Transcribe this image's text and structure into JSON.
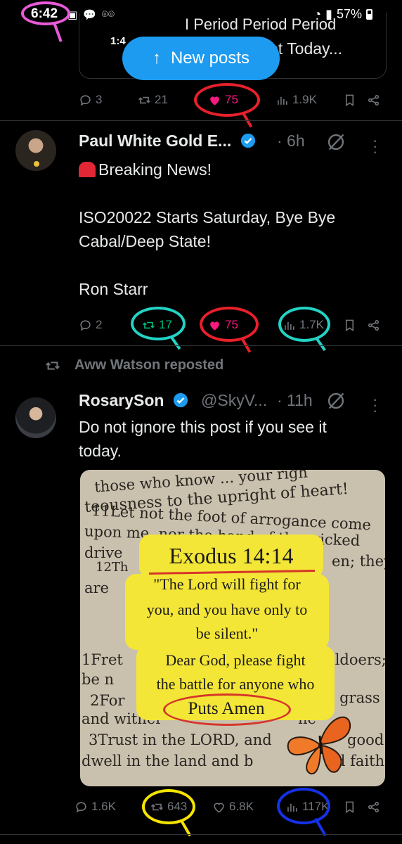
{
  "status_bar": {
    "time": "6:42",
    "battery": "57%"
  },
  "quoted_card": {
    "top_text": "I Period Period Period",
    "time": "1:4",
    "text": "et Today..."
  },
  "new_posts_button": {
    "label": "New posts"
  },
  "tweet0_actions": {
    "replies": "3",
    "reposts": "21",
    "likes": "75",
    "views": "1.9K"
  },
  "tweet1": {
    "name": "Paul White Gold E...",
    "time": "· 6h",
    "lines": [
      "Breaking News!",
      "",
      "ISO20022 Starts Saturday, Bye Bye",
      "Cabal/Deep State!",
      "",
      "Ron Starr"
    ],
    "actions": {
      "replies": "2",
      "reposts": "17",
      "likes": "75",
      "views": "1.7K"
    }
  },
  "repost_label": "Aww Watson reposted",
  "tweet2": {
    "name": "RosarySon",
    "handle": "@SkyV...",
    "time": "· 11h",
    "lines": [
      "Do not ignore this post if you see it",
      "today."
    ],
    "image": {
      "page_lines": [
        "those who know ... your righ",
        "teousness to the upright of heart!",
        "11Let not the foot of arrogance come",
        "upon me, nor the hand of the wicked",
        "drive",
        "12Th",
        "are",
        "1Fret",
        "be n",
        "2For",
        "and wither",
        "3Trust in the LORD, and",
        "dwell in the land and b"
      ],
      "page_right": [
        "en; they",
        "ildoers;",
        "e grass",
        "he",
        "good",
        "d faith"
      ],
      "title": "Exodus 14:14",
      "quote": [
        "\"The Lord will fight for",
        "you, and you have only to",
        "be silent.\""
      ],
      "prayer": [
        "Dear God, please fight",
        "the battle for anyone who"
      ],
      "amen": "Puts Amen"
    },
    "actions": {
      "replies": "1.6K",
      "reposts": "643",
      "likes": "6.8K",
      "views": "117K"
    }
  },
  "colors": {
    "accent": "#1d9bf0",
    "like_pink": "#f91880",
    "repost_green": "#00ba7c",
    "muted": "#71767b",
    "annot_magenta": "#e85ad8",
    "annot_red": "#e8202a",
    "annot_cyan": "#22d3c5",
    "annot_yellow": "#f5e400",
    "annot_blue": "#1432e6"
  }
}
